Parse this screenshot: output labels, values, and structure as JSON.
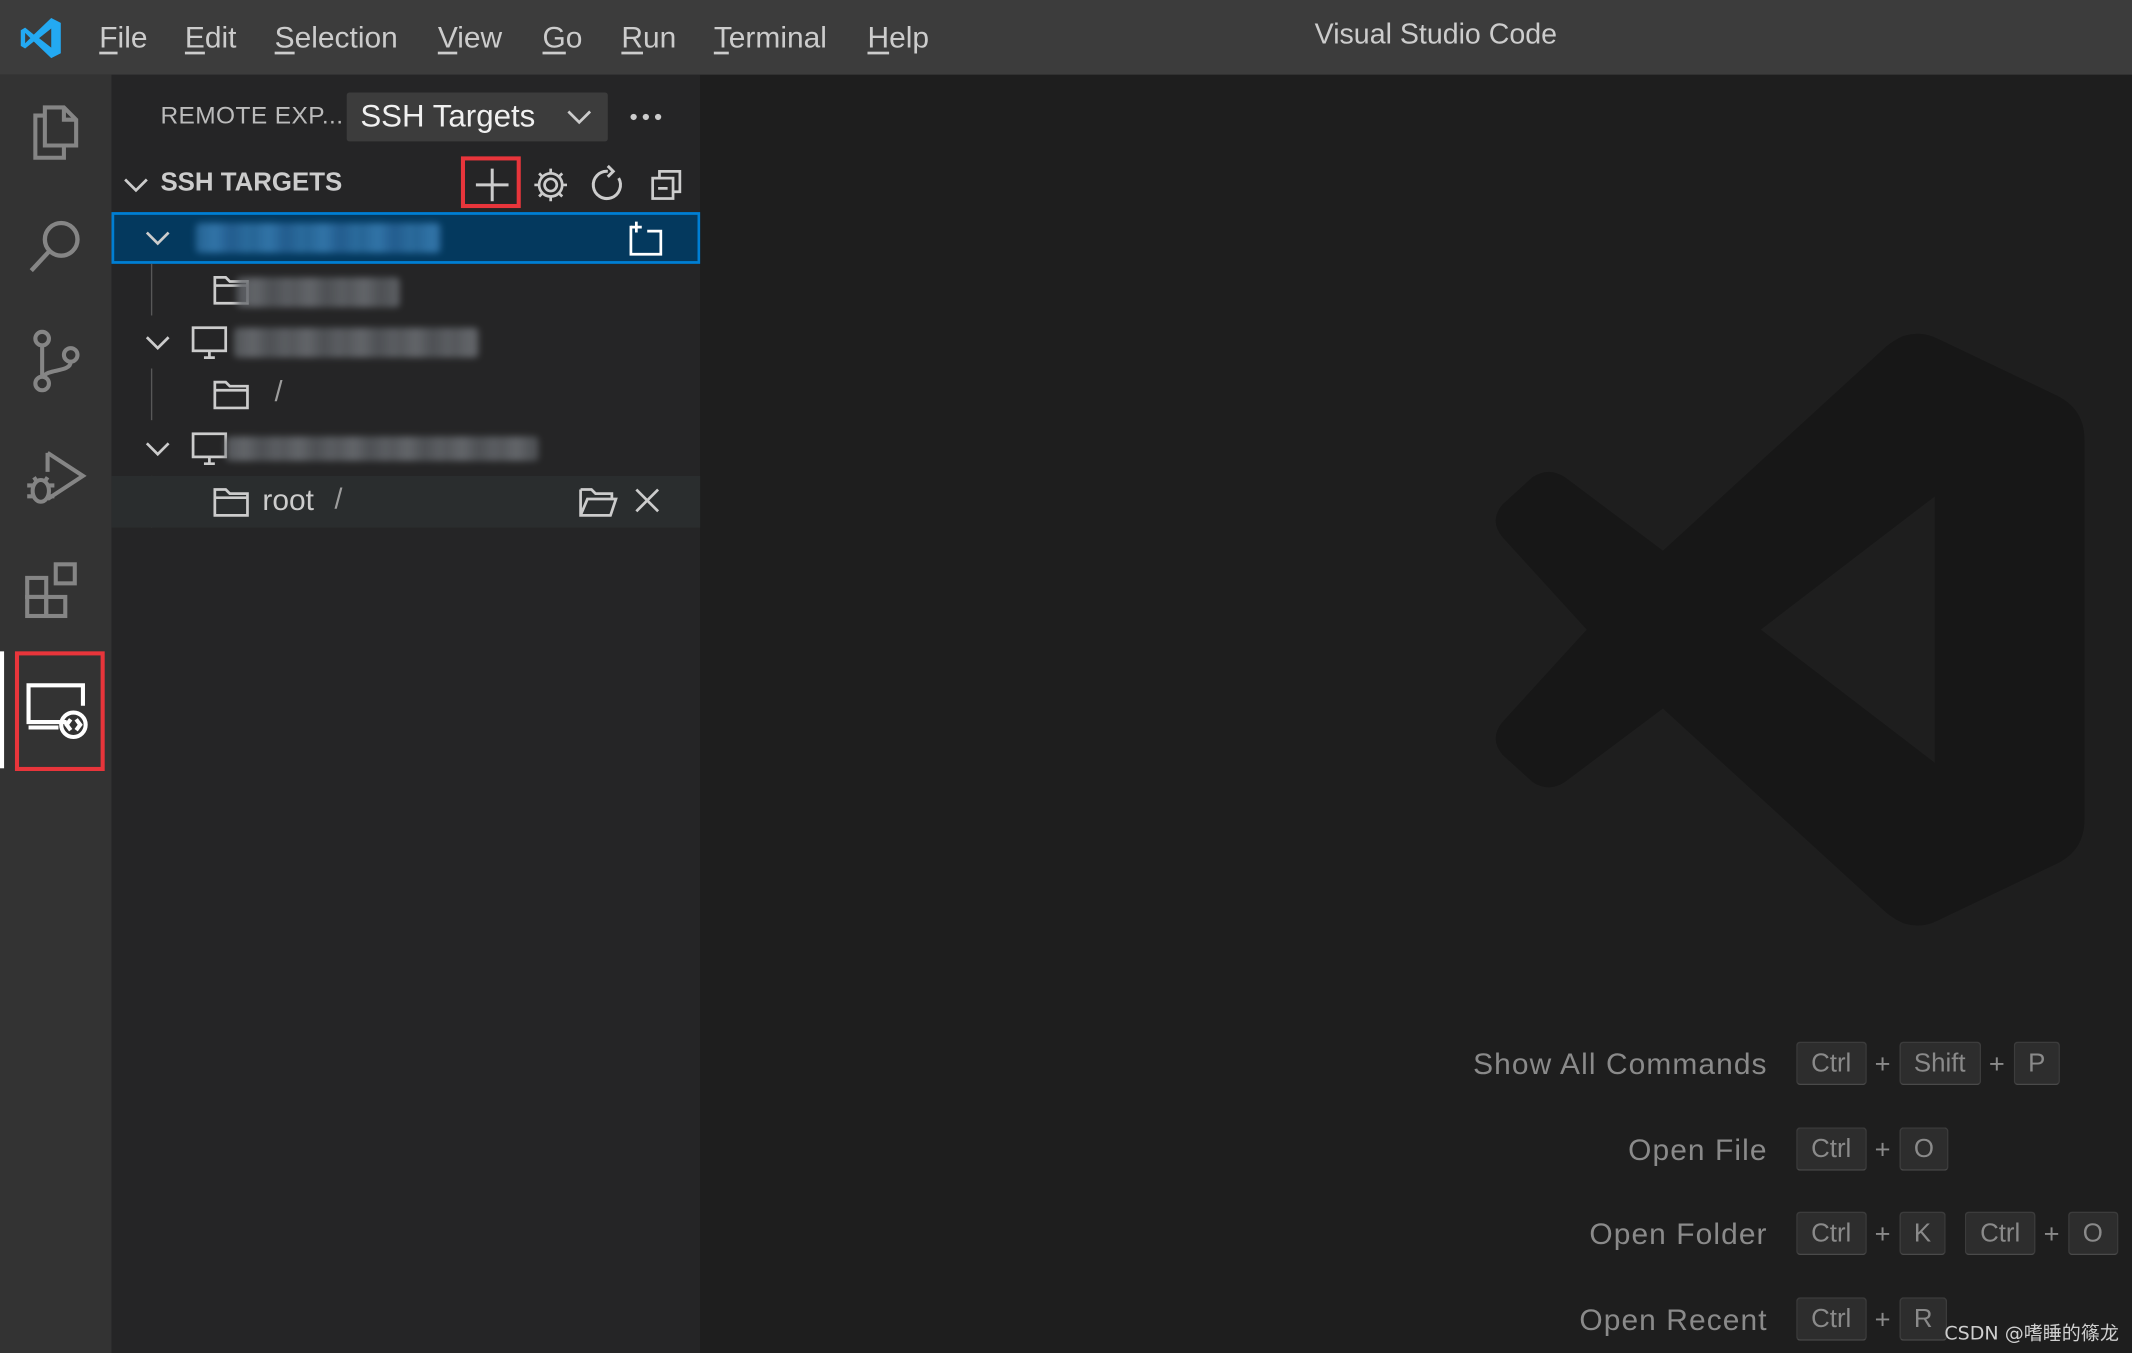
{
  "titlebar": {
    "menu": [
      {
        "mnemonic": "F",
        "rest": "ile"
      },
      {
        "mnemonic": "E",
        "rest": "dit"
      },
      {
        "mnemonic": "S",
        "rest": "election"
      },
      {
        "mnemonic": "V",
        "rest": "iew"
      },
      {
        "mnemonic": "G",
        "rest": "o"
      },
      {
        "mnemonic": "R",
        "rest": "un"
      },
      {
        "mnemonic": "T",
        "rest": "erminal"
      },
      {
        "mnemonic": "H",
        "rest": "elp"
      }
    ],
    "window_title": "Visual Studio Code"
  },
  "activity_bar": {
    "items": [
      "explorer-icon",
      "search-icon",
      "source-control-icon",
      "run-debug-icon",
      "extensions-icon",
      "remote-explorer-icon"
    ],
    "active": "remote-explorer-icon"
  },
  "sidebar": {
    "title": "REMOTE EXP...",
    "target_select": "SSH Targets",
    "section_title": "SSH TARGETS",
    "tree": {
      "host2_folder": "/",
      "host3_folder_name": "root",
      "host3_folder_path": "/"
    }
  },
  "editor": {
    "shortcuts": [
      {
        "label": "Show All Commands",
        "keys": [
          [
            "Ctrl",
            "Shift",
            "P"
          ]
        ]
      },
      {
        "label": "Open File",
        "keys": [
          [
            "Ctrl",
            "O"
          ]
        ]
      },
      {
        "label": "Open Folder",
        "keys": [
          [
            "Ctrl",
            "K"
          ],
          [
            "Ctrl",
            "O"
          ]
        ]
      },
      {
        "label": "Open Recent",
        "keys": [
          [
            "Ctrl",
            "R"
          ]
        ]
      }
    ]
  },
  "watermark_text": "CSDN @嗜睡的篠龙",
  "colors": {
    "titlebar": "#3c3c3c",
    "activity_bar": "#333333",
    "sidebar": "#252526",
    "editor": "#1e1e1e",
    "selection": "#04395e",
    "focus_border": "#007fd4",
    "annotation_red": "#e8353b",
    "vscode_blue": "#23a9f2"
  }
}
